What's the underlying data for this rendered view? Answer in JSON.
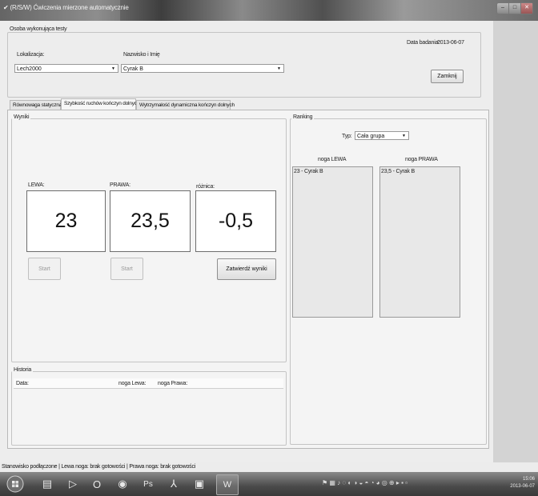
{
  "window": {
    "title": "(R/S/W) Ćwiczenia mierzone automatycznie"
  },
  "header": {
    "person_group": "Osoba wykonująca testy",
    "location_label": "Lokalizacja:",
    "location_value": "Lech2000",
    "name_label": "Nazwisko i Imię",
    "name_value": "Cyrak B",
    "date_label": "Data badania:",
    "date_value": "2013-06-07",
    "close_button": "Zamknij"
  },
  "tabs": [
    {
      "label": "Równowaga statyczna"
    },
    {
      "label": "Szybkość ruchów kończyn dolnych"
    },
    {
      "label": "Wytrzymałość dynamiczna kończyn dolnych"
    }
  ],
  "results": {
    "group": "Wyniki",
    "left_label": "LEWA:",
    "left_value": "23",
    "right_label": "PRAWA:",
    "right_value": "23,5",
    "diff_label": "różnica:",
    "diff_value": "-0,5",
    "start_left": "Start",
    "start_right": "Start",
    "confirm": "Zatwierdź wyniki"
  },
  "history": {
    "group": "Historia",
    "col_date": "Data:",
    "col_left": "noga Lewa:",
    "col_right": "noga Prawa:"
  },
  "ranking": {
    "group": "Ranking",
    "type_label": "Typ:",
    "type_value": "Cała grupa",
    "left_header": "noga LEWA",
    "right_header": "noga PRAWA",
    "left_items": [
      "23 - Cyrak B"
    ],
    "right_items": [
      "23,5 - Cyrak B"
    ]
  },
  "status": {
    "text": "Stanowisko podłączone  |  Lewa noga: brak gotowości  |  Prawa noga: brak gotowości"
  },
  "taskbar": {
    "time": "15:06",
    "date": "2013-06-07",
    "apps": [
      "start-orb-icon",
      "explorer-icon",
      "media-player-icon",
      "opera-icon",
      "chrome-icon",
      "photoshop-icon",
      "acrobat-icon",
      "app-window-icon",
      "word-icon"
    ]
  }
}
